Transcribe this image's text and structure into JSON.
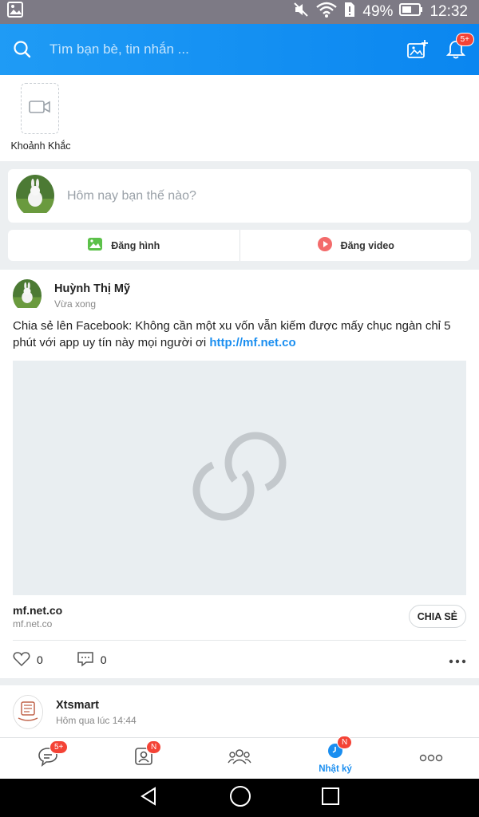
{
  "status_bar": {
    "battery": "49%",
    "time": "12:32"
  },
  "header": {
    "search_placeholder": "Tìm bạn bè, tin nhắn ...",
    "notification_badge": "5+"
  },
  "moments": {
    "label": "Khoảnh Khắc"
  },
  "compose": {
    "placeholder": "Hôm nay bạn thế nào?"
  },
  "post_actions": {
    "photo_label": "Đăng hình",
    "video_label": "Đăng video"
  },
  "post": {
    "author": "Huỳnh Thị Mỹ",
    "time": "Vừa xong",
    "text": "Chia sẻ lên Facebook: Không cần một xu vốn vẫn kiếm được mấy chục ngàn chỉ 5 phút với app uy tín này mọi người ơi ",
    "link": "http://mf.net.co",
    "link_domain": "mf.net.co",
    "link_sub": "mf.net.co",
    "share_label": "CHIA SẺ",
    "like_count": "0",
    "comment_count": "0"
  },
  "post2": {
    "author": "Xtsmart",
    "time": "Hôm qua lúc 14:44"
  },
  "bottom_nav": {
    "messages_badge": "5+",
    "contacts_badge": "N",
    "timeline_badge": "N",
    "timeline_label": "Nhật ký"
  },
  "colors": {
    "header_blue": "#0a86f0",
    "accent_blue": "#1a8ef0",
    "badge_red": "#f44336"
  }
}
